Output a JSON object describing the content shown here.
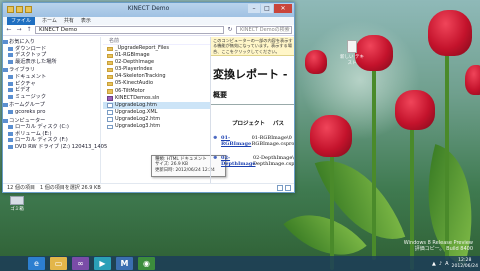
{
  "window": {
    "title": "KINECT Demo",
    "ribbon": [
      "ファイル",
      "ホーム",
      "共有",
      "表示"
    ],
    "address": "KINECT Demo",
    "search_placeholder": "KINECT Demoの検索"
  },
  "nav": {
    "items": [
      {
        "label": "お気に入り",
        "group": true
      },
      {
        "label": "ダウンロード"
      },
      {
        "label": "デスクトップ"
      },
      {
        "label": "最近表示した場所"
      },
      {
        "label": "ライブラリ",
        "group": true
      },
      {
        "label": "ドキュメント"
      },
      {
        "label": "ピクチャ"
      },
      {
        "label": "ビデオ"
      },
      {
        "label": "ミュージック"
      },
      {
        "label": "ホームグループ",
        "group": true
      },
      {
        "label": "gcoreks pro"
      },
      {
        "label": "コンピューター",
        "group": true
      },
      {
        "label": "ローカル ディスク (C:)"
      },
      {
        "label": "ボリューム (E:)"
      },
      {
        "label": "ローカル ディスク (F:)"
      },
      {
        "label": "DVD RW ドライブ (Z:) 120413_1405"
      }
    ]
  },
  "files": {
    "header": "名前",
    "items": [
      {
        "name": "_UpgradeReport_Files",
        "type": "folder"
      },
      {
        "name": "01-RGBImage",
        "type": "folder"
      },
      {
        "name": "02-DepthImage",
        "type": "folder"
      },
      {
        "name": "03-PlayerIndex",
        "type": "folder"
      },
      {
        "name": "04-SkeletonTracking",
        "type": "folder"
      },
      {
        "name": "05-KinectAudio",
        "type": "folder"
      },
      {
        "name": "06-TiltMotor",
        "type": "folder"
      },
      {
        "name": "KINECTDemos.sln",
        "type": "sln"
      },
      {
        "name": "UpgradeLog.htm",
        "type": "doc",
        "selected": true
      },
      {
        "name": "UpgradeLog.XML",
        "type": "doc"
      },
      {
        "name": "UpgradeLog2.htm",
        "type": "doc"
      },
      {
        "name": "UpgradeLog3.htm",
        "type": "doc"
      }
    ]
  },
  "tooltip": {
    "line1": "種類: HTML ドキュメント",
    "line2": "サイズ: 26.9 KB",
    "line3": "更新日時: 2012/06/24 12:24"
  },
  "status": {
    "text": "12 個の項目　1 個の項目を選択 26.9 KB"
  },
  "preview": {
    "notice": "このコンピューターの一部の内容を表示する機能が無効になっています。表示する場合、ここをクリックしてください。",
    "heading": "変換レポート -",
    "subheading": "概要",
    "col_project": "プロジェクト",
    "col_path": "パス",
    "rows": [
      {
        "link": "01-RGBImage",
        "path": "01-RGBImage\\0 RGBImage.csproj"
      },
      {
        "link": "02-DepthImage",
        "path": "02-DepthImage\\ DepthImage.csp"
      }
    ]
  },
  "desktop": {
    "icon_label": "ゴミ箱",
    "doc_label": "新しい テキスト",
    "watermark_line1": "Windows 8 Release Preview",
    "watermark_line2": "評価コピー。 Build 8400"
  },
  "taskbar": {
    "apps": [
      "IE",
      "Explorer",
      "VS",
      "Media",
      "Kinect",
      "Chrome"
    ],
    "time": "12:28",
    "date": "2012/06/24",
    "lang": "A"
  }
}
